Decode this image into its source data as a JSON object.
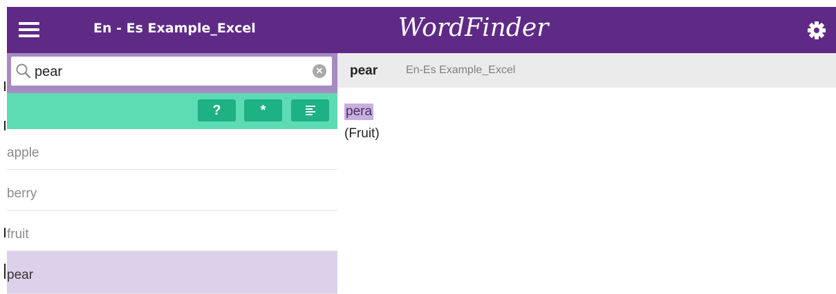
{
  "header": {
    "title": "En - Es Example_Excel",
    "brand": "WordFinder",
    "menu_icon": "menu-icon",
    "settings_icon": "gear-icon"
  },
  "search": {
    "value": "pear",
    "placeholder": "",
    "search_icon": "search-icon",
    "clear_icon": "clear-icon"
  },
  "toolbar": {
    "buttons": [
      {
        "label": "?",
        "icon": "question-icon"
      },
      {
        "label": "*",
        "icon": "wildcard-icon"
      },
      {
        "label": "",
        "icon": "list-icon"
      }
    ]
  },
  "word_list": {
    "items": [
      {
        "label": "apple"
      },
      {
        "label": "berry"
      },
      {
        "label": "fruit"
      },
      {
        "label": "pear",
        "selected": true
      }
    ]
  },
  "entry": {
    "headword": "pear",
    "source": "En-Es Example_Excel",
    "translation": "pera",
    "gloss": "(Fruit)"
  },
  "colors": {
    "header_bg": "#5f2a86",
    "search_frame": "#a88ac3",
    "toolbar_bg": "#5ddbb2",
    "tool_button": "#1db183",
    "selected_row": "#ddd0ea",
    "highlight": "#c6b0de"
  }
}
